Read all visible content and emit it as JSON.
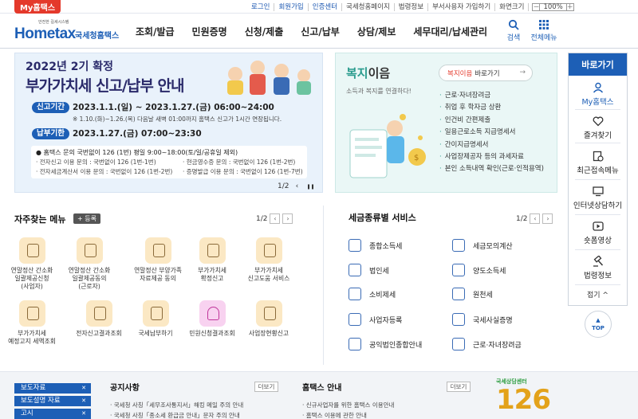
{
  "utility": {
    "my_tab": "My홈택스",
    "links": [
      "로그인",
      "회원가입",
      "인증센터",
      "국세청홈페이지",
      "법령정보",
      "부서사용자 가입하기",
      "화면크기"
    ],
    "zoom_value": "100%",
    "zoom_minus": "－",
    "zoom_plus": "＋"
  },
  "header": {
    "logo_sub": "안전한 길세시스템",
    "logo_main": "Hometax",
    "logo_nts": "국세청홈택스",
    "nav": [
      "조회/발급",
      "민원증명",
      "신청/제출",
      "신고/납부",
      "상담/제보",
      "세무대리/납세관리"
    ],
    "search_label": "검색",
    "allmenu_label": "전체메뉴"
  },
  "banner": {
    "year": "2022년 2기 확정",
    "title": "부가가치세 신고/납부 안내",
    "period_label": "신고기간",
    "period_value": "2023.1.1.(일) ~ 2023.1.27.(금) 06:00~24:00",
    "period_note": "※ 1.10.(화)~1.26.(목) 다음날 새벽 01:00까지 홈택스 신고가 1시간 연장됩니다.",
    "pay_label": "납부기한",
    "pay_value": "2023.1.27.(금) 07:00~23:30",
    "inquiry_1": "● 홈택스 문의 국번없이 126 (1번) 평일 9:00~18:00(토/일/공휴일 제외)",
    "inquiry_2": "· 전자신고 이용 문의 : 국번없이 126 (1번-1번)",
    "inquiry_3": "· 현금영수증 문의 : 국번없이 126 (1번-2번)",
    "inquiry_4": "· 전자세금계산서 이용 문의 : 국번없이 126 (1번-2번)",
    "inquiry_5": "· 증명발급 이용 문의 : 국번없이 126 (1번-7번)",
    "page": "1/2",
    "prev": "‹",
    "pause": "❚❚",
    "next": "›"
  },
  "welfare": {
    "title_colored": "복지",
    "title_plain": "이음",
    "subtitle": "소득과 복지를 연결하다!",
    "button_red": "복지이음",
    "button_text": "바로가기",
    "button_arrow": "→",
    "items": [
      "근로·자녀장려금",
      "취업 후 학자금 상환",
      "인건비 간편제출",
      "일용근로소득 지급명세서",
      "간이지급명세서",
      "사업장제공자 등의 과세자료",
      "본인 소득내역 확인(근로·인적용역)"
    ]
  },
  "quick_menu": {
    "header": "바로가기",
    "items": [
      "My홈택스",
      "즐겨찾기",
      "최근접속메뉴",
      "인터넷상담하기",
      "숏폼영상",
      "법령정보"
    ],
    "close": "접기 ^",
    "top": "TOP"
  },
  "favorites": {
    "title": "자주찾는 메뉴",
    "add_label": "+ 등록",
    "page": "1/2",
    "prev": "‹",
    "next": "›",
    "items": [
      [
        "연말정산 간소화",
        "일괄제공신청",
        "(사업자)"
      ],
      [
        "연말정산 간소화",
        "일괄제공동의",
        "(근로자)"
      ],
      [
        "연말정산 부양가족",
        "자료제공 동의"
      ],
      [
        "부가가치세",
        "확정신고"
      ],
      [
        "부가가치세",
        "신고도움 서비스"
      ],
      [
        "부가가치세",
        "예정고지 세액조회"
      ],
      [
        "전자신고결과조회"
      ],
      [
        "국세납부하기"
      ],
      [
        "민원신청결과조회"
      ],
      [
        "사업장현황신고"
      ]
    ]
  },
  "tax_services": {
    "title": "세금종류별 서비스",
    "page": "1/2",
    "prev": "‹",
    "next": "›",
    "items": [
      "종합소득세",
      "세금모의계산",
      "법인세",
      "양도소득세",
      "소비제세",
      "원천세",
      "사업자등록",
      "국세사실증명",
      "공익법인종합안내",
      "근로·자녀장려금"
    ]
  },
  "footer": {
    "tabs": [
      "보도자료",
      "보도설명 자료",
      "고시"
    ],
    "tab_close": "✕",
    "notice_title": "공지사항",
    "notice_more": "더보기",
    "notices": [
      "국세청 사칭「세무조사통지서」해킹 메일 주의 안내",
      "국세청 사칭「종소세 환급금 안내」문자 주의 안내"
    ],
    "guide_title": "홈택스 안내",
    "guide_more": "더보기",
    "guides": [
      "신규사업자를 위한 홈택스 이용안내",
      "홈택스 이용에 관한 안내"
    ],
    "center_title": "국세상담센터",
    "center_number": "126"
  },
  "colors": {
    "brand_blue": "#1d5fb6",
    "accent_red": "#e4392b",
    "welfare_teal": "#2b9c8e",
    "banner_bg": "#e9f2fb"
  }
}
